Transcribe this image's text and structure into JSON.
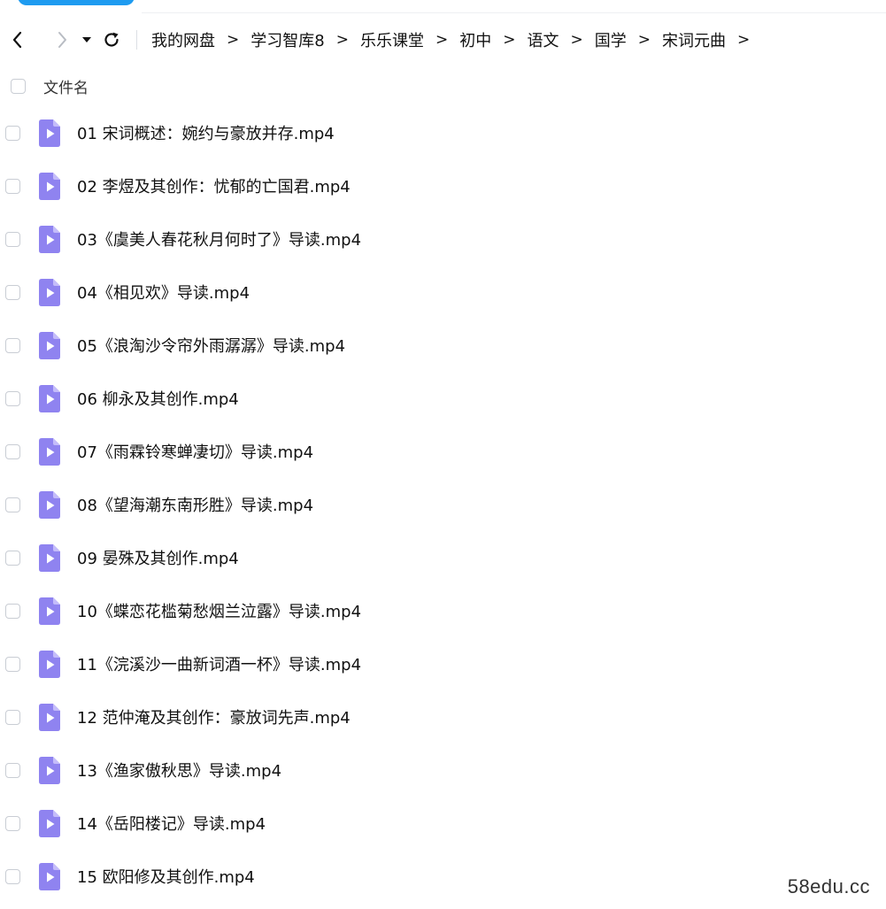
{
  "nav": {
    "back_icon": "chevron-left-icon",
    "forward_icon": "chevron-right-icon",
    "dropdown_icon": "caret-down-icon",
    "refresh_icon": "refresh-icon"
  },
  "breadcrumb": {
    "items": [
      "我的网盘",
      "学习智库8",
      "乐乐课堂",
      "初中",
      "语文",
      "国学",
      "宋词元曲"
    ],
    "separator": ">"
  },
  "table": {
    "header": "文件名"
  },
  "files": [
    {
      "name": "01 宋词概述：婉约与豪放并存.mp4"
    },
    {
      "name": "02 李煜及其创作：忧郁的亡国君.mp4"
    },
    {
      "name": "03《虞美人春花秋月何时了》导读.mp4"
    },
    {
      "name": "04《相见欢》导读.mp4"
    },
    {
      "name": "05《浪淘沙令帘外雨潺潺》导读.mp4"
    },
    {
      "name": "06 柳永及其创作.mp4"
    },
    {
      "name": "07《雨霖铃寒蝉凄切》导读.mp4"
    },
    {
      "name": "08《望海潮东南形胜》导读.mp4"
    },
    {
      "name": "09 晏殊及其创作.mp4"
    },
    {
      "name": "10《蝶恋花槛菊愁烟兰泣露》导读.mp4"
    },
    {
      "name": "11《浣溪沙一曲新词酒一杯》导读.mp4"
    },
    {
      "name": "12 范仲淹及其创作：豪放词先声.mp4"
    },
    {
      "name": "13《渔家傲秋思》导读.mp4"
    },
    {
      "name": "14《岳阳楼记》导读.mp4"
    },
    {
      "name": "15 欧阳修及其创作.mp4"
    }
  ],
  "file_icon": "video-file-icon",
  "colors": {
    "accent": "#1e9bf0",
    "file_icon_body": "#8f83f0",
    "file_icon_fold": "#c4bcfa"
  },
  "watermark": "58edu.cc"
}
